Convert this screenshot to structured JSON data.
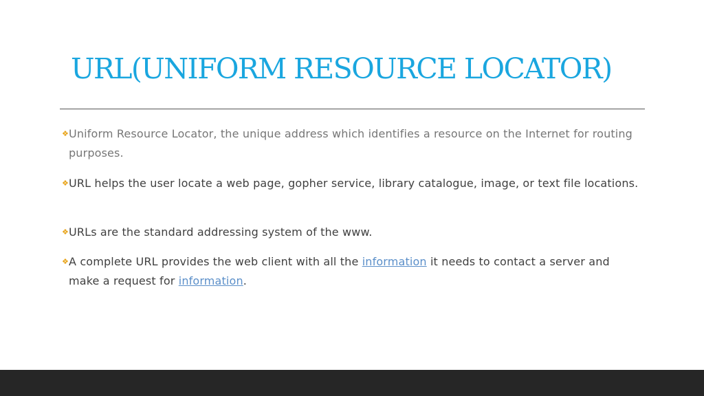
{
  "slide": {
    "title": "URL(UNIFORM RESOURCE LOCATOR)"
  },
  "bullets": [
    {
      "text": "Uniform Resource Locator, the unique address which identifies a resource on the Internet for routing purposes."
    },
    {
      "text": "URL helps the user locate a web page, gopher service, library catalogue, image, or text file locations."
    },
    {
      "text": "URLs are the standard addressing system of the www."
    },
    {
      "part1": "A complete URL provides the web client with all the ",
      "link1": "information",
      "part2": " it needs to contact a server and make a request for ",
      "link2": "information",
      "part3": "."
    }
  ],
  "bullet_icon": "diamond-cluster-icon",
  "colors": {
    "title": "#1aa6df",
    "bullet_icon": "#e8a317",
    "text_light": "#767676",
    "text_dark": "#404040",
    "link": "#5b8fc9",
    "footer_bar": "#262626"
  }
}
